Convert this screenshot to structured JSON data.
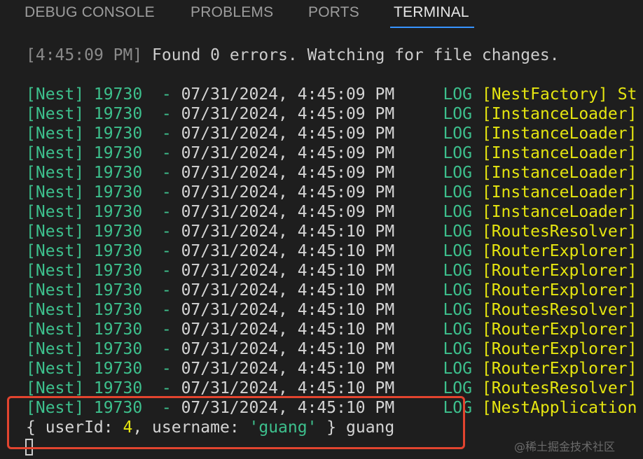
{
  "tabs": {
    "debug_console": "DEBUG CONSOLE",
    "problems": "PROBLEMS",
    "ports": "PORTS",
    "terminal": "TERMINAL"
  },
  "terminal": {
    "watch_line": {
      "time_open": "[",
      "time": "4:45:09 PM",
      "time_close": "]",
      "message": " Found 0 errors. Watching for file changes."
    },
    "log_lines": [
      {
        "prefix": "[Nest] 19730  - ",
        "datetime": "07/31/2024, 4:45:09 PM",
        "level": "LOG",
        "context": "[NestFactory] St"
      },
      {
        "prefix": "[Nest] 19730  - ",
        "datetime": "07/31/2024, 4:45:09 PM",
        "level": "LOG",
        "context": "[InstanceLoader]"
      },
      {
        "prefix": "[Nest] 19730  - ",
        "datetime": "07/31/2024, 4:45:09 PM",
        "level": "LOG",
        "context": "[InstanceLoader]"
      },
      {
        "prefix": "[Nest] 19730  - ",
        "datetime": "07/31/2024, 4:45:09 PM",
        "level": "LOG",
        "context": "[InstanceLoader]"
      },
      {
        "prefix": "[Nest] 19730  - ",
        "datetime": "07/31/2024, 4:45:09 PM",
        "level": "LOG",
        "context": "[InstanceLoader]"
      },
      {
        "prefix": "[Nest] 19730  - ",
        "datetime": "07/31/2024, 4:45:09 PM",
        "level": "LOG",
        "context": "[InstanceLoader]"
      },
      {
        "prefix": "[Nest] 19730  - ",
        "datetime": "07/31/2024, 4:45:09 PM",
        "level": "LOG",
        "context": "[InstanceLoader]"
      },
      {
        "prefix": "[Nest] 19730  - ",
        "datetime": "07/31/2024, 4:45:10 PM",
        "level": "LOG",
        "context": "[RoutesResolver]"
      },
      {
        "prefix": "[Nest] 19730  - ",
        "datetime": "07/31/2024, 4:45:10 PM",
        "level": "LOG",
        "context": "[RouterExplorer]"
      },
      {
        "prefix": "[Nest] 19730  - ",
        "datetime": "07/31/2024, 4:45:10 PM",
        "level": "LOG",
        "context": "[RouterExplorer]"
      },
      {
        "prefix": "[Nest] 19730  - ",
        "datetime": "07/31/2024, 4:45:10 PM",
        "level": "LOG",
        "context": "[RouterExplorer]"
      },
      {
        "prefix": "[Nest] 19730  - ",
        "datetime": "07/31/2024, 4:45:10 PM",
        "level": "LOG",
        "context": "[RoutesResolver]"
      },
      {
        "prefix": "[Nest] 19730  - ",
        "datetime": "07/31/2024, 4:45:10 PM",
        "level": "LOG",
        "context": "[RouterExplorer]"
      },
      {
        "prefix": "[Nest] 19730  - ",
        "datetime": "07/31/2024, 4:45:10 PM",
        "level": "LOG",
        "context": "[RouterExplorer]"
      },
      {
        "prefix": "[Nest] 19730  - ",
        "datetime": "07/31/2024, 4:45:10 PM",
        "level": "LOG",
        "context": "[RouterExplorer]"
      },
      {
        "prefix": "[Nest] 19730  - ",
        "datetime": "07/31/2024, 4:45:10 PM",
        "level": "LOG",
        "context": "[RoutesResolver]"
      },
      {
        "prefix": "[Nest] 19730  - ",
        "datetime": "07/31/2024, 4:45:10 PM",
        "level": "LOG",
        "context": "[NestApplication"
      }
    ],
    "output_line": {
      "open": "{ userId: ",
      "user_id": "4",
      "mid": ", username: ",
      "username": "'guang'",
      "close": " } guang"
    }
  },
  "watermark": "@稀土掘金技术社区",
  "colors": {
    "background": "#1e1e1e",
    "tab_active_underline": "#3794ff",
    "log_green": "#3dc08d",
    "context_yellow": "#e5e510",
    "highlight_box": "#e2442f"
  }
}
